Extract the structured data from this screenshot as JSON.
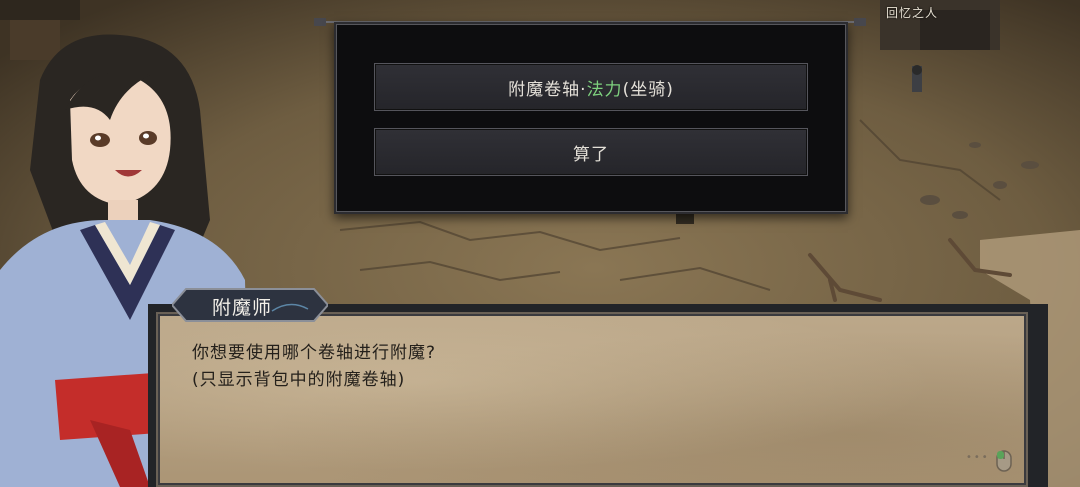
{
  "area": {
    "label": "回忆之人"
  },
  "choices": {
    "option1_prefix": "附魔卷轴·",
    "option1_highlight": "法力",
    "option1_suffix": "(坐骑)",
    "option2": "算了"
  },
  "dialog": {
    "speaker": "附魔师",
    "line1": "你想要使用哪个卷轴进行附魔?",
    "line2": "(只显示背包中的附魔卷轴)"
  },
  "icons": {
    "continue": "mouse-icon",
    "more": "ellipsis-icon"
  },
  "colors": {
    "highlight": "#7ed07e",
    "dialog_bg": "#bca88a",
    "panel_bg": "#0d0d0f"
  }
}
